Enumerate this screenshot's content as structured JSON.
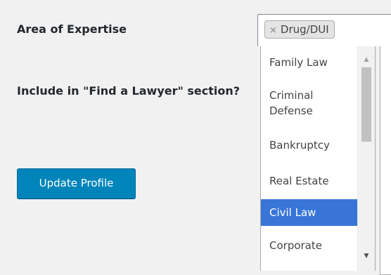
{
  "form": {
    "expertise_label": "Area of Expertise",
    "include_label": "Include in \"Find a Lawyer\" section?",
    "update_button_label": "Update Profile"
  },
  "expertise_select": {
    "selected_chips": [
      {
        "remove_symbol": "×",
        "label": "Drug/DUI"
      }
    ],
    "options": [
      {
        "label": "Family Law",
        "highlighted": false
      },
      {
        "label": "Criminal Defense",
        "highlighted": false
      },
      {
        "label": "Bankruptcy",
        "highlighted": false
      },
      {
        "label": "Real Estate",
        "highlighted": false
      },
      {
        "label": "Civil Law",
        "highlighted": true
      },
      {
        "label": "Corporate",
        "highlighted": false
      }
    ],
    "scrollbar": {
      "up_arrow": "▲",
      "down_arrow": "▼"
    }
  },
  "colors": {
    "page_background": "#f1f1f1",
    "primary_button": "#0085ba",
    "highlighted_option": "#3875d7"
  }
}
